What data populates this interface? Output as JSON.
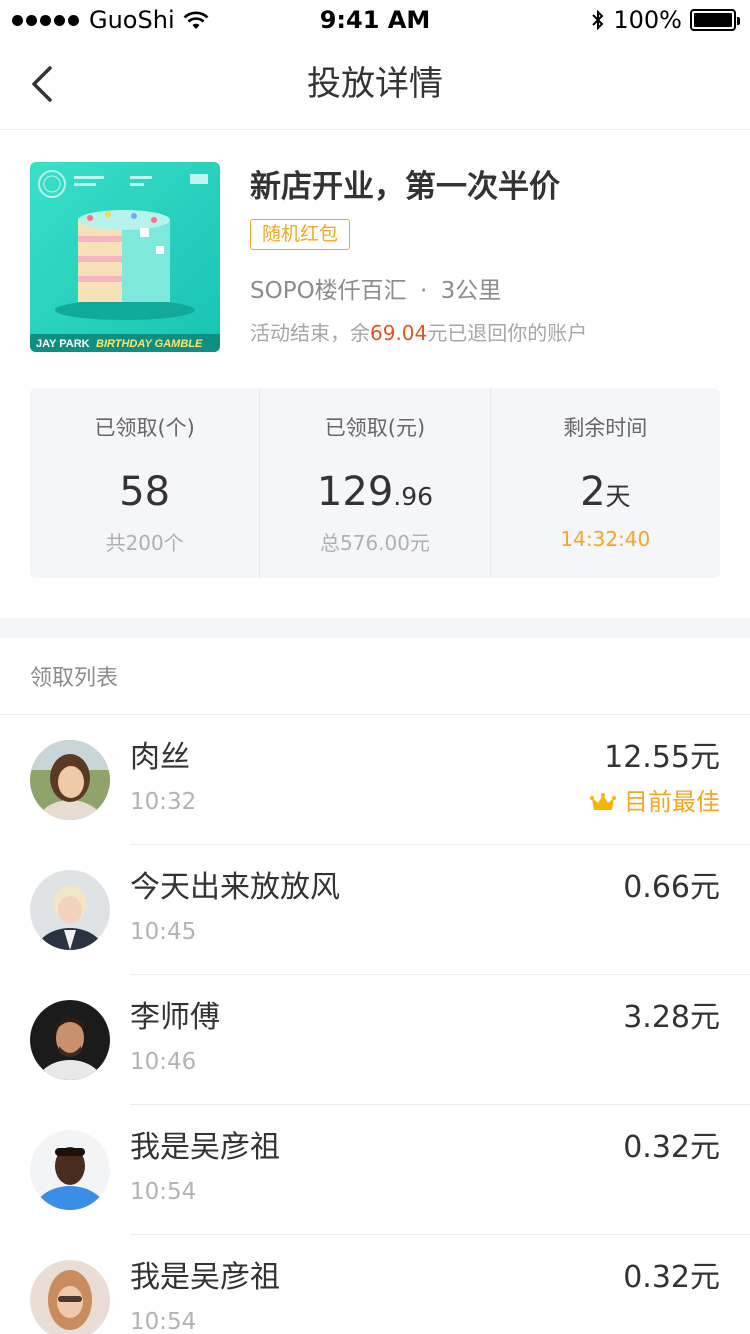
{
  "status_bar": {
    "carrier": "GuoShi",
    "time": "9:41 AM",
    "battery": "100%"
  },
  "nav": {
    "title": "投放详情",
    "back_icon": "chevron-left-icon"
  },
  "campaign": {
    "title": "新店开业，第一次半价",
    "tag": "随机红包",
    "store": "SOPO楼仟百汇",
    "separator": "·",
    "distance": "3公里",
    "refund_prefix": "活动结束，余",
    "refund_amount": "69.04",
    "refund_suffix": "元已退回你的账户",
    "cover_artist": "JAY PARK",
    "cover_album": "BIRTHDAY GAMBLE"
  },
  "stats": [
    {
      "label": "已领取(个)",
      "value": "58",
      "value_small": "",
      "sub": "共200个"
    },
    {
      "label": "已领取(元)",
      "value": "129",
      "value_small": ".96",
      "sub": "总576.00元"
    },
    {
      "label": "剩余时间",
      "value": "2",
      "value_small": "天",
      "sub": "14:32:40"
    }
  ],
  "list": {
    "header": "领取列表",
    "best_label": "目前最佳",
    "items": [
      {
        "name": "肉丝",
        "time": "10:32",
        "amount": "12.55元"
      },
      {
        "name": "今天出来放放风",
        "time": "10:45",
        "amount": "0.66元"
      },
      {
        "name": "李师傅",
        "time": "10:46",
        "amount": "3.28元"
      },
      {
        "name": "我是吴彦祖",
        "time": "10:54",
        "amount": "0.32元"
      },
      {
        "name": "我是吴彦祖",
        "time": "10:54",
        "amount": "0.32元"
      }
    ]
  },
  "colors": {
    "accent": "#f5a623",
    "refund": "#e8501f",
    "panel": "#f5f6fa"
  }
}
